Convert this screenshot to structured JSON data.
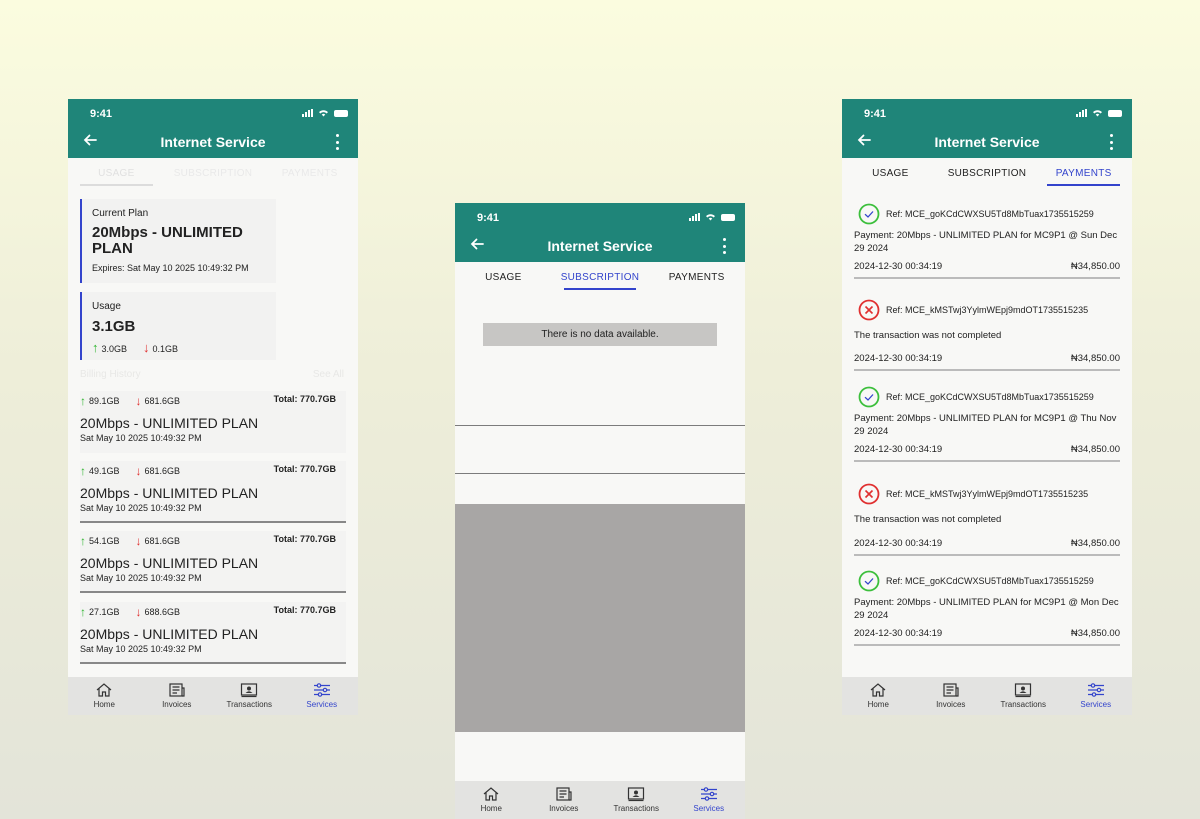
{
  "status_time": "9:41",
  "app_title": "Internet Service",
  "tabs": [
    "USAGE",
    "SUBSCRIPTION",
    "PAYMENTS"
  ],
  "nav": [
    "Home",
    "Invoices",
    "Transactions",
    "Services"
  ],
  "colors": {
    "primary": "#1f8579",
    "accent": "#3344cc",
    "up": "#2fb52f",
    "down": "#e03030"
  },
  "usage_screen": {
    "current_plan_label": "Current Plan",
    "current_plan_name": "20Mbps - UNLIMITED PLAN",
    "expires": "Expires: Sat May 10 2025 10:49:32 PM",
    "usage_label": "Usage",
    "usage_total": "3.1GB",
    "usage_up": "3.0GB",
    "usage_down": "0.1GB",
    "billing_history_label": "Billing History",
    "see_all": "See All",
    "billing": [
      {
        "up": "89.1GB",
        "down": "681.6GB",
        "total": "Total: 770.7GB",
        "plan": "20Mbps - UNLIMITED PLAN",
        "date": "Sat May 10 2025 10:49:32 PM"
      },
      {
        "up": "49.1GB",
        "down": "681.6GB",
        "total": "Total: 770.7GB",
        "plan": "20Mbps - UNLIMITED PLAN",
        "date": "Sat May 10 2025 10:49:32 PM"
      },
      {
        "up": "54.1GB",
        "down": "681.6GB",
        "total": "Total: 770.7GB",
        "plan": "20Mbps - UNLIMITED PLAN",
        "date": "Sat May 10 2025 10:49:32 PM"
      },
      {
        "up": "27.1GB",
        "down": "688.6GB",
        "total": "Total: 770.7GB",
        "plan": "20Mbps - UNLIMITED PLAN",
        "date": "Sat May 10 2025 10:49:32 PM"
      }
    ]
  },
  "subscription_screen": {
    "empty_message": "There is no data available."
  },
  "payments_screen": {
    "items": [
      {
        "status": "success",
        "ref": "Ref: MCE_goKCdCWXSU5Td8MbTuax1735515259",
        "desc": "Payment: 20Mbps - UNLIMITED PLAN for MC9P1 @ Sun Dec 29 2024",
        "date": "2024-12-30 00:34:19",
        "amount": "₦34,850.00"
      },
      {
        "status": "failed",
        "ref": "Ref: MCE_kMSTwj3YylmWEpj9mdOT1735515235",
        "desc": "The transaction was not completed",
        "date": "2024-12-30 00:34:19",
        "amount": "₦34,850.00"
      },
      {
        "status": "success",
        "ref": "Ref: MCE_goKCdCWXSU5Td8MbTuax1735515259",
        "desc": "Payment: 20Mbps - UNLIMITED PLAN for MC9P1 @ Thu Nov 29 2024",
        "date": "2024-12-30 00:34:19",
        "amount": "₦34,850.00"
      },
      {
        "status": "failed",
        "ref": "Ref: MCE_kMSTwj3YylmWEpj9mdOT1735515235",
        "desc": "The transaction was not completed",
        "date": "2024-12-30 00:34:19",
        "amount": "₦34,850.00"
      },
      {
        "status": "success",
        "ref": "Ref: MCE_goKCdCWXSU5Td8MbTuax1735515259",
        "desc": "Payment: 20Mbps - UNLIMITED PLAN for MC9P1 @ Mon Dec 29 2024",
        "date": "2024-12-30 00:34:19",
        "amount": "₦34,850.00"
      }
    ]
  }
}
